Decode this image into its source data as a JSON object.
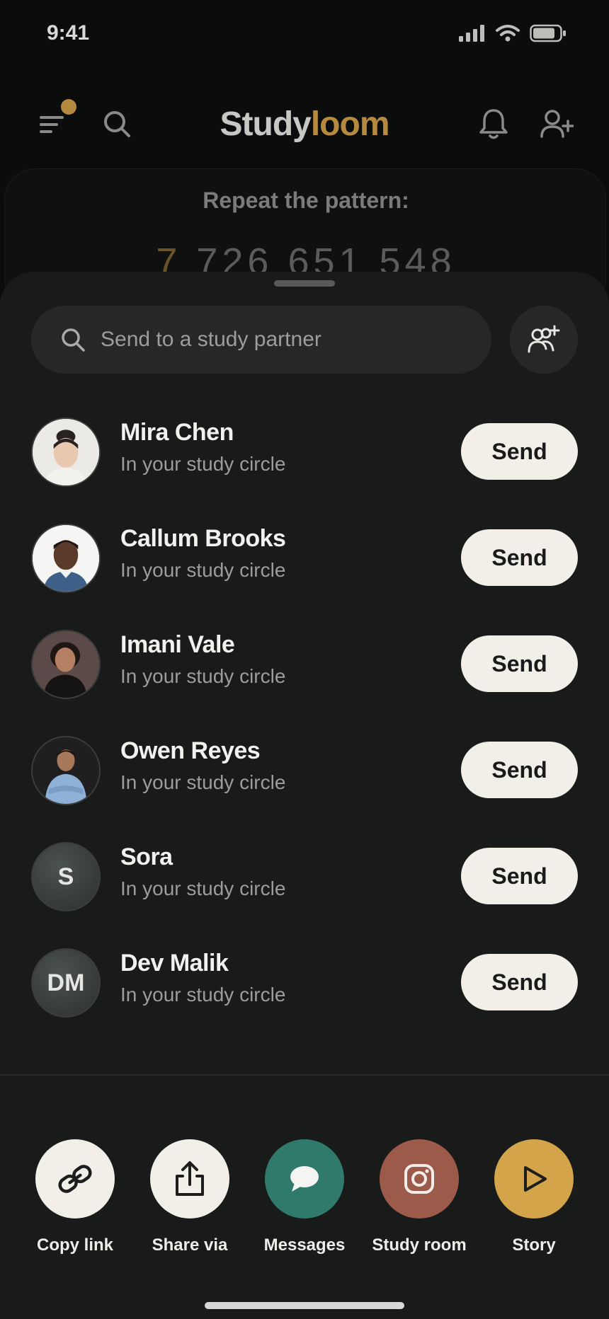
{
  "status": {
    "time": "9:41"
  },
  "app": {
    "logo_part1": "Study",
    "logo_part2": "loom"
  },
  "background": {
    "prompt": "Repeat the pattern:",
    "first_digit": "7",
    "digits_rest": " 726 651 548"
  },
  "sheet": {
    "search_placeholder": "Send to a study partner",
    "send_label": "Send",
    "contacts": [
      {
        "name": "Mira Chen",
        "subtitle": "In your study circle",
        "avatar": "photo"
      },
      {
        "name": "Callum Brooks",
        "subtitle": "In your study circle",
        "avatar": "photo"
      },
      {
        "name": "Imani Vale",
        "subtitle": "In your study circle",
        "avatar": "photo"
      },
      {
        "name": "Owen Reyes",
        "subtitle": "In your study circle",
        "avatar": "photo"
      },
      {
        "name": "Sora",
        "subtitle": "In your study circle",
        "initials": "S"
      },
      {
        "name": "Dev Malik",
        "subtitle": "In your study circle",
        "initials": "DM"
      }
    ],
    "share_options": [
      {
        "label": "Copy link",
        "icon": "link-icon",
        "color": "#f1efe8"
      },
      {
        "label": "Share via",
        "icon": "share-icon",
        "color": "#f1efe8"
      },
      {
        "label": "Messages",
        "icon": "chat-bubble-icon",
        "color": "#2f7a6a"
      },
      {
        "label": "Study room",
        "icon": "instagram-icon",
        "color": "#9c5a4a"
      },
      {
        "label": "Story",
        "icon": "play-icon",
        "color": "#d3a44a"
      }
    ]
  },
  "colors": {
    "accent": "#b58a3e",
    "sheet": "#191a1a",
    "button": "#f1efe8"
  }
}
